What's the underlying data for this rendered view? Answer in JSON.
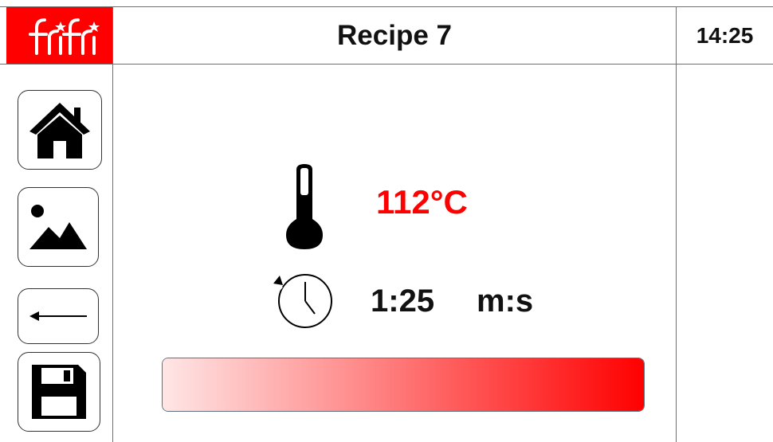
{
  "header": {
    "logo_text": "frifri",
    "title": "Recipe 7",
    "time": "14:25"
  },
  "nav": {
    "home_icon": "home-icon",
    "gallery_icon": "image-icon",
    "back_icon": "arrow-left-icon",
    "save_icon": "floppy-disk-icon"
  },
  "main": {
    "temperature": "112°C",
    "temperature_icon": "thermometer-icon",
    "time_value": "1:25",
    "time_unit": "m:s",
    "time_icon": "timer-icon",
    "progress": 1.0
  },
  "colors": {
    "brand": "#ff0000",
    "temperature": "#ff0000",
    "progress_end": "#ff0000",
    "progress_start": "#ffe6e6"
  }
}
